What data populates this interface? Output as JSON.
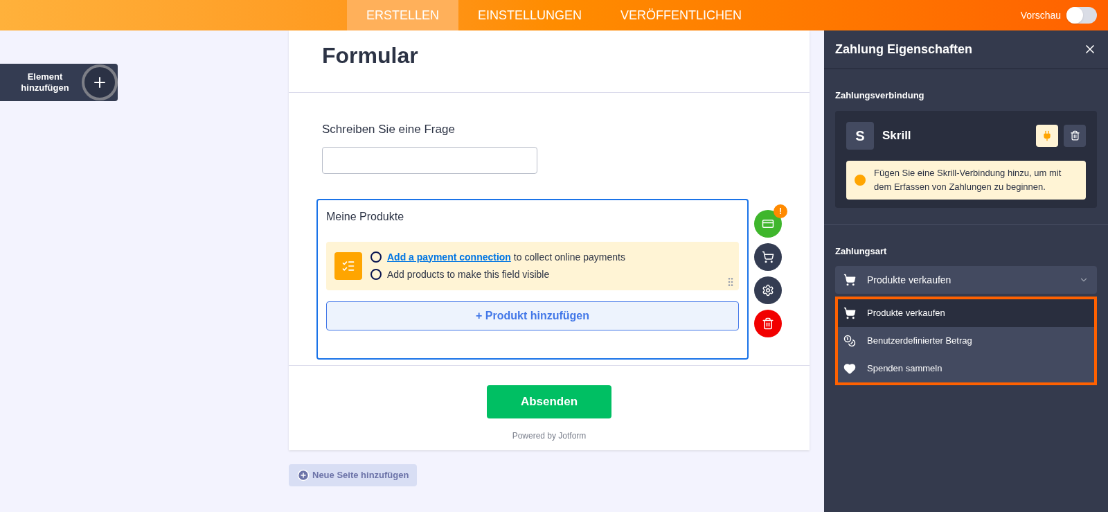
{
  "topbar": {
    "tabs": [
      {
        "label": "ERSTELLEN",
        "selected": true
      },
      {
        "label": "EINSTELLUNGEN",
        "selected": false
      },
      {
        "label": "VERÖFFENTLICHEN",
        "selected": false
      }
    ],
    "preview": {
      "label": "Vorschau",
      "on": false
    }
  },
  "add_element": {
    "label": "Element hinzufügen"
  },
  "form": {
    "title": "Formular",
    "question": {
      "label": "Schreiben Sie eine Frage"
    },
    "products": {
      "label": "Meine Produkte",
      "checklist": [
        {
          "link": "Add a payment connection",
          "text": "to collect online payments",
          "checked": false
        },
        {
          "text": "Add products to make this field visible",
          "checked": false
        }
      ],
      "add_product": "+ Produkt hinzufügen"
    },
    "tools": [
      {
        "kind": "payment",
        "badge": "!"
      },
      {
        "kind": "cart"
      },
      {
        "kind": "settings"
      },
      {
        "kind": "delete"
      }
    ],
    "submit": "Absenden",
    "powered": "Powered by Jotform"
  },
  "new_page": "Neue Seite hinzufügen",
  "panel": {
    "title": "Zahlung Eigenschaften",
    "connection": {
      "heading": "Zahlungsverbindung",
      "logo": "S",
      "name": "Skrill",
      "tooltip": "Fügen Sie eine Skrill-Verbindung hinzu, um mit dem Erfassen von Zahlungen zu beginnen."
    },
    "payment_type": {
      "heading": "Zahlungsart",
      "value": "Produkte verkaufen",
      "expanded": true,
      "options": [
        {
          "kind": "cart",
          "label": "Produkte verkaufen",
          "selected": true
        },
        {
          "kind": "coins",
          "label": "Benutzerdefinierter Betrag",
          "selected": false
        },
        {
          "kind": "heart",
          "label": "Spenden sammeln",
          "selected": false
        }
      ]
    }
  }
}
